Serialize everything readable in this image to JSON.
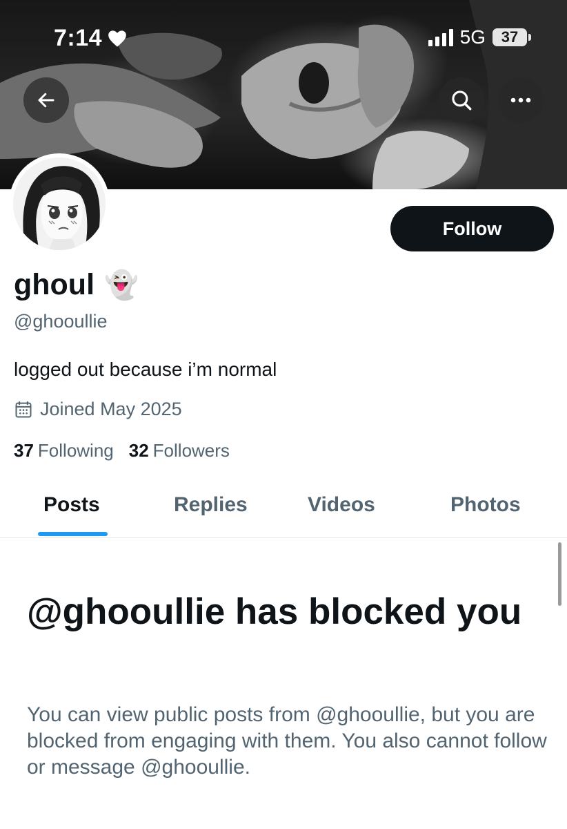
{
  "status_bar": {
    "time": "7:14",
    "network": "5G",
    "battery": "37",
    "heart_icon": "heart-icon",
    "signal_icon": "cellular-signal-icon"
  },
  "header": {
    "back_icon": "arrow-left-icon",
    "search_icon": "search-icon",
    "more_icon": "more-horizontal-icon"
  },
  "profile": {
    "display_name": "ghoul",
    "name_emoji": "👻",
    "handle": "@ghooullie",
    "bio": "logged out because i’m normal",
    "joined": "Joined May 2025",
    "joined_icon": "calendar-icon",
    "following_count": "37",
    "following_label": "Following",
    "followers_count": "32",
    "followers_label": "Followers",
    "follow_label": "Follow"
  },
  "tabs": [
    {
      "label": "Posts",
      "active": true
    },
    {
      "label": "Replies",
      "active": false
    },
    {
      "label": "Videos",
      "active": false
    },
    {
      "label": "Photos",
      "active": false
    }
  ],
  "blocked": {
    "title": "@ghooullie has blocked you",
    "body": "You can view public posts from @ghooullie, but you are blocked from engaging with them. You also cannot follow or message @ghooullie."
  },
  "colors": {
    "primary_text": "#0f1419",
    "secondary_text": "#536471",
    "accent_blue": "#1d9bf0",
    "follow_button": "#0f1419"
  }
}
